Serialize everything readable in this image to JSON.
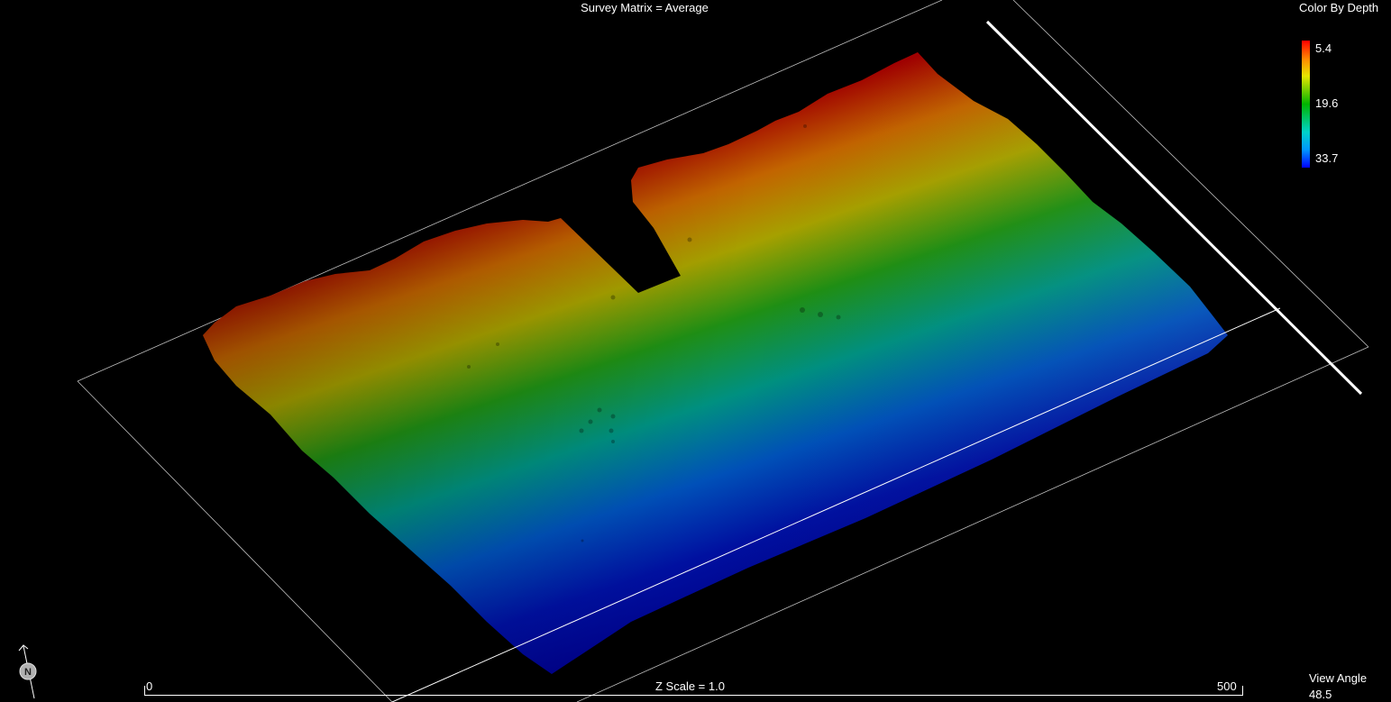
{
  "view": {
    "title": "Survey Matrix = Average",
    "z_scale": "Z Scale = 1.0",
    "view_angle_label": "View Angle",
    "view_angle_value": "48.5"
  },
  "legend": {
    "title": "Color By Depth",
    "max": "5.4",
    "mid": "19.6",
    "min": "33.7",
    "colors": [
      "#ff0000",
      "#ff8c00",
      "#e6e600",
      "#00b400",
      "#00d2c8",
      "#0096ff",
      "#0000ff"
    ]
  },
  "scale_bar": {
    "start": "0",
    "end": "500"
  },
  "compass": {
    "letter": "N",
    "icon": "north-arrow-icon"
  },
  "surface": {
    "depth_ramp_colors": [
      "#a00000",
      "#c26400",
      "#a6a000",
      "#1f8f14",
      "#009080",
      "#0050b8",
      "#0010a0",
      "#000088"
    ]
  }
}
